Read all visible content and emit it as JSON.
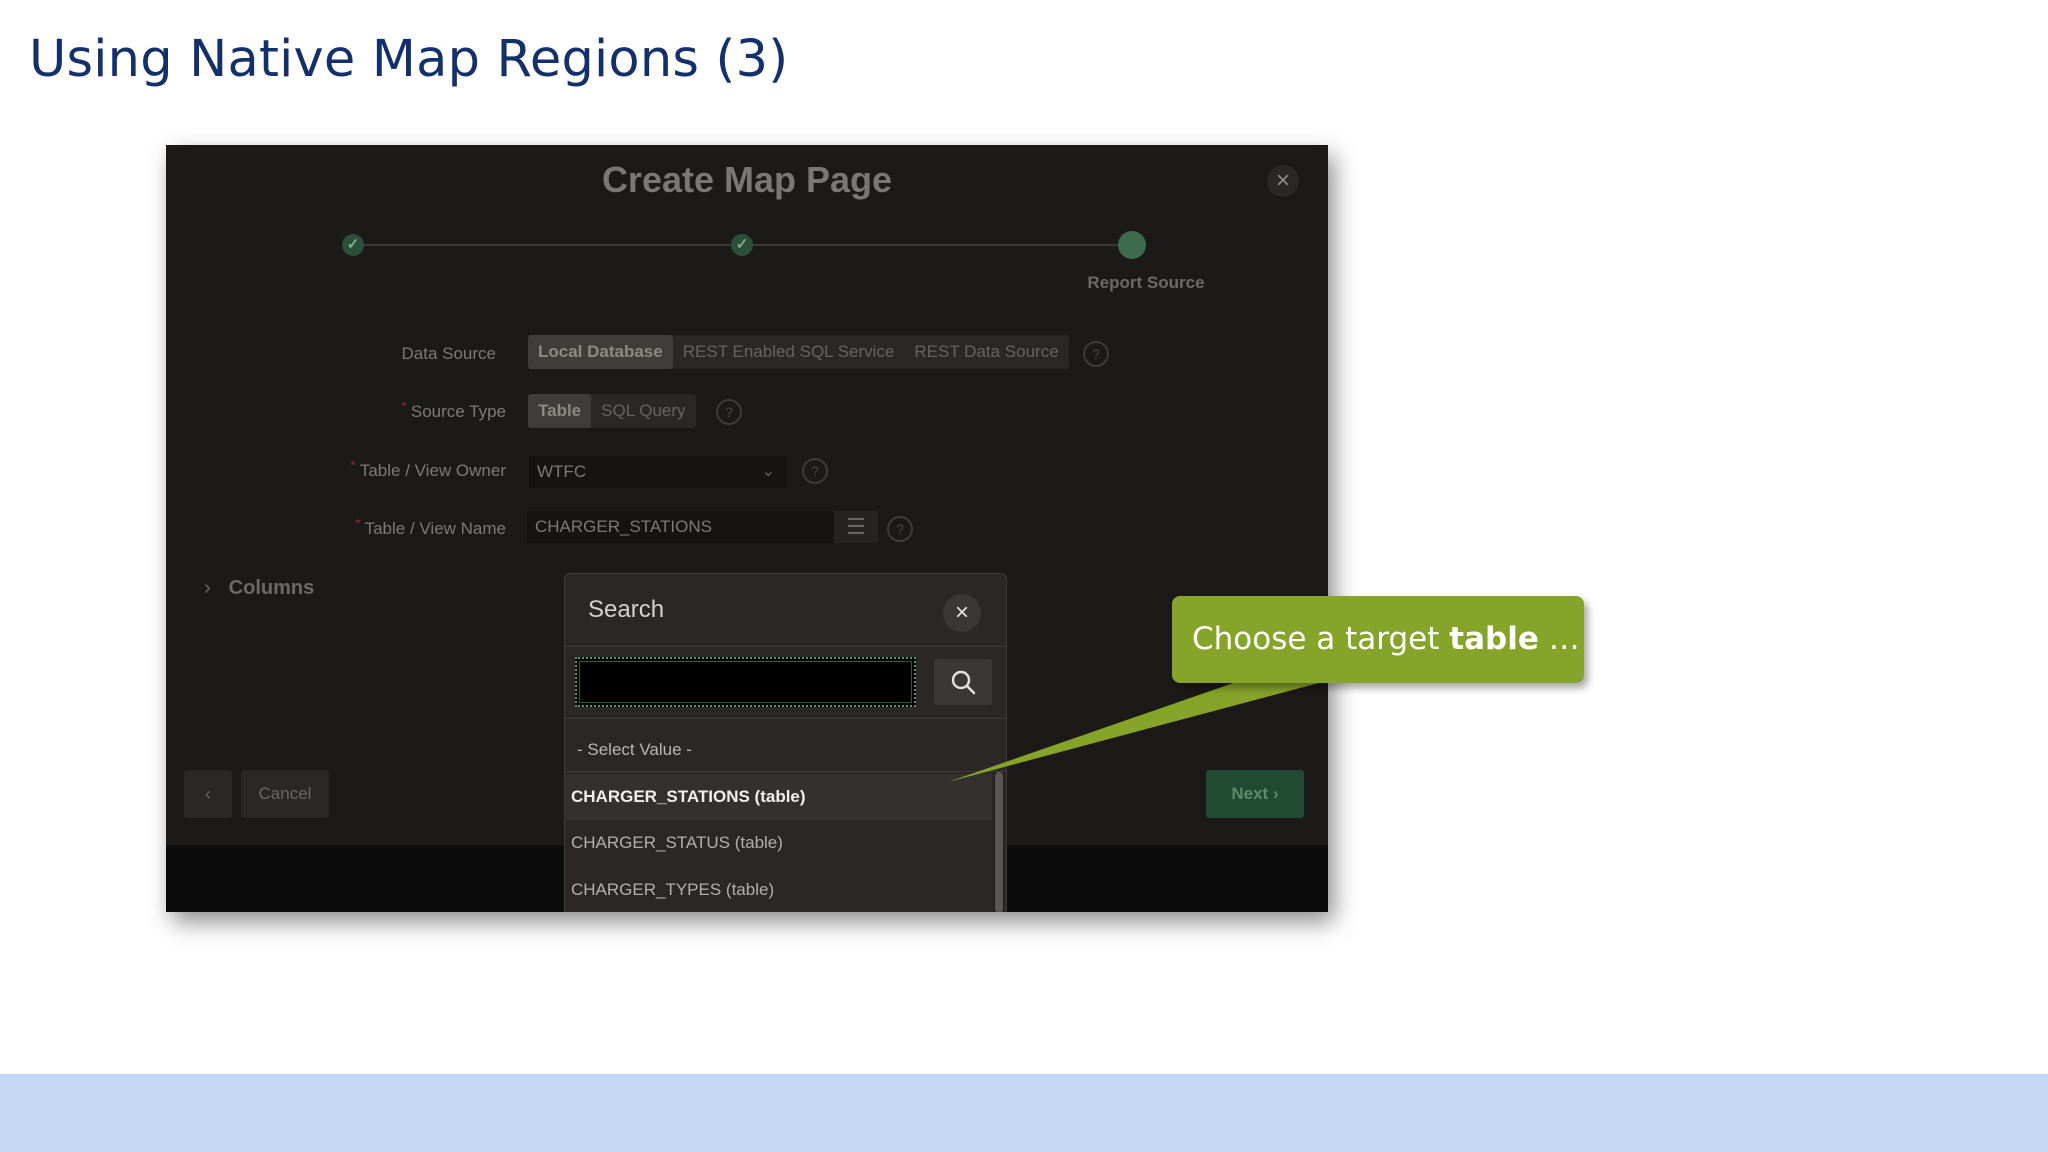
{
  "slide": {
    "title": "Using Native Map Regions (3)"
  },
  "dialog": {
    "title": "Create Map Page",
    "close_icon": "×",
    "steps": [
      {
        "status": "done"
      },
      {
        "status": "done"
      },
      {
        "status": "current",
        "label": "Report Source"
      }
    ],
    "data_source": {
      "label": "Data Source",
      "options": [
        "Local Database",
        "REST Enabled SQL Service",
        "REST Data Source"
      ],
      "selected": "Local Database"
    },
    "source_type": {
      "label": "Source Type",
      "options": [
        "Table",
        "SQL Query"
      ],
      "selected": "Table"
    },
    "table_owner": {
      "label": "Table / View Owner",
      "value": "WTFC"
    },
    "table_name": {
      "label": "Table / View Name",
      "value": "CHARGER_STATIONS"
    },
    "columns_label": "Columns",
    "buttons": {
      "cancel": "Cancel",
      "next": "Next"
    }
  },
  "search_popup": {
    "title": "Search",
    "input_value": "",
    "select_value": "- Select Value -",
    "options": [
      "CHARGER_STATIONS (table)",
      "CHARGER_STATUS (table)",
      "CHARGER_TYPES (table)"
    ],
    "active_index": 0
  },
  "callout": {
    "text_prefix": "Choose a target ",
    "text_bold": "table",
    "text_suffix": " …"
  },
  "colors": {
    "title_blue": "#13306b",
    "band_blue": "#c5d8f3",
    "callout_green": "#86a429"
  }
}
